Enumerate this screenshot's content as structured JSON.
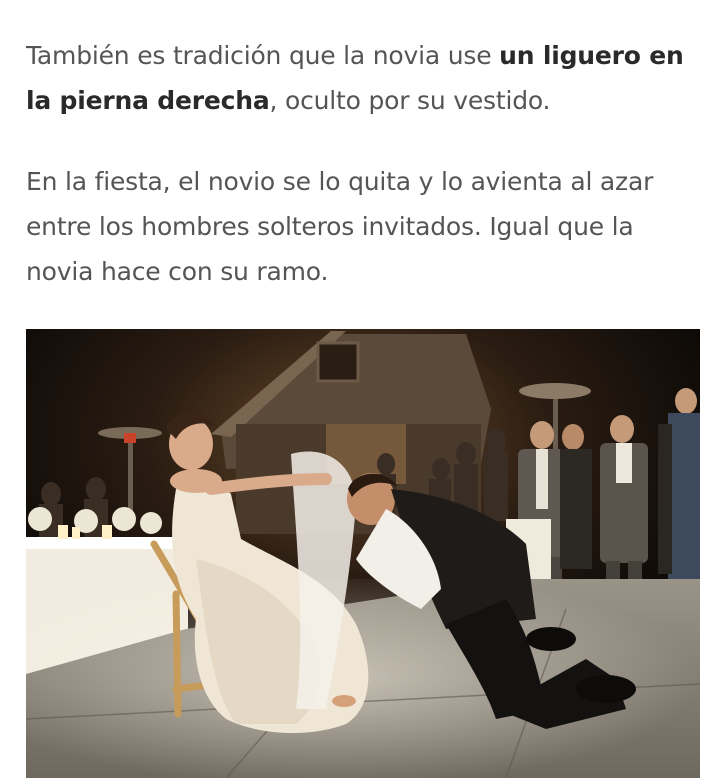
{
  "article": {
    "paragraph1": {
      "before": "También es tradición que la novia use ",
      "bold": "un liguero en la pierna derecha",
      "after": ", oculto por su vestido."
    },
    "paragraph2": "En la fiesta, el novio se lo quita y lo avienta al azar entre los hombres solteros invitados. Igual que la novia hace con su ramo."
  },
  "photo": {
    "icon": "wedding-garter-photo"
  },
  "colors": {
    "body_text": "#555555",
    "bold_text": "#2a2a2a",
    "background": "#ffffff"
  }
}
